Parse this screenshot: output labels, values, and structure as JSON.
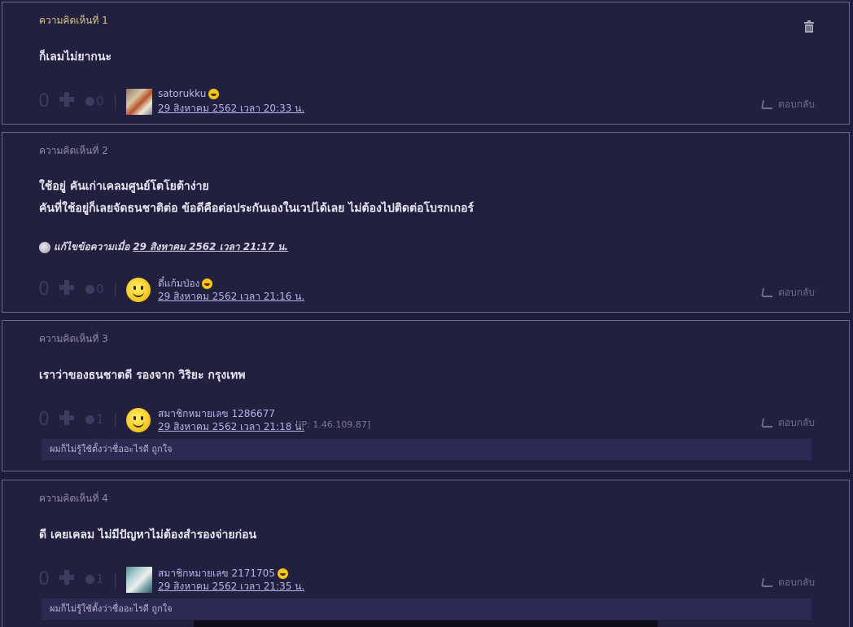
{
  "comments": [
    {
      "heading": "ความคิดเห็นที่ 1",
      "body": [
        "ก็เลมไม่ยากนะ"
      ],
      "votes": "0",
      "emotions": "0",
      "author": "satorukku",
      "date": "29 สิงหาคม 2562 เวลา 20:33 น.",
      "reply": "ตอบกลับ",
      "avatar": "photo-avatar",
      "trash_icon": "trash-icon"
    },
    {
      "heading": "ความคิดเห็นที่ 2",
      "body": [
        "ใช้อยู่ คันเก่าเคลมศูนย์โตโยต้าง่าย",
        "คันที่ใช้อยู่ก็เลยจัดธนชาติต่อ ข้อดีคือต่อประกันเองในเวปได้เลย ไม่ต้องไปติดต่อโบรกเกอร์"
      ],
      "edit_prefix": "แก้ไขข้อความเมื่อ",
      "edit_time": "29 สิงหาคม 2562 เวลา 21:17 น.",
      "votes": "0",
      "emotions": "0",
      "author": "ดี๋แก้มป่อง",
      "date": "29 สิงหาคม 2562 เวลา 21:16 น.",
      "reply": "ตอบกลับ",
      "avatar": "smiley-avatar"
    },
    {
      "heading": "ความคิดเห็นที่ 3",
      "body": [
        "เราว่าของธนชาตดี รองจาก วิริยะ กรุงเทพ"
      ],
      "votes": "0",
      "emotions": "1",
      "author": "สมาชิกหมายเลข 1286677",
      "date": "29 สิงหาคม 2562 เวลา 21:18 น.",
      "ip": "[IP: 1.46.109.87]",
      "reply": "ตอบกลับ",
      "signature": "ผมก็ไม่รู้ใช้ตั้งว่าชื่ออะไรดี ถูกใจ",
      "avatar": "smiley-avatar"
    },
    {
      "heading": "ความคิดเห็นที่ 4",
      "body": [
        "ดี เคยเคลม ไม่มีปัญหาไม่ต้องสำรองจ่ายก่อน"
      ],
      "votes": "0",
      "emotions": "1",
      "author": "สมาชิกหมายเลข 2171705",
      "date": "29 สิงหาคม 2562 เวลา 21:35 น.",
      "reply": "ตอบกลับ",
      "signature": "ผมก็ไม่รู้ใช้ตั้งว่าชื่ออะไรดี ถูกใจ",
      "avatar": "photo-avatar"
    }
  ],
  "colors": {
    "background": "#1f1d3e",
    "card": "#22203f",
    "author_link": "#b7b5e8",
    "first_heading": "#d8c889"
  }
}
